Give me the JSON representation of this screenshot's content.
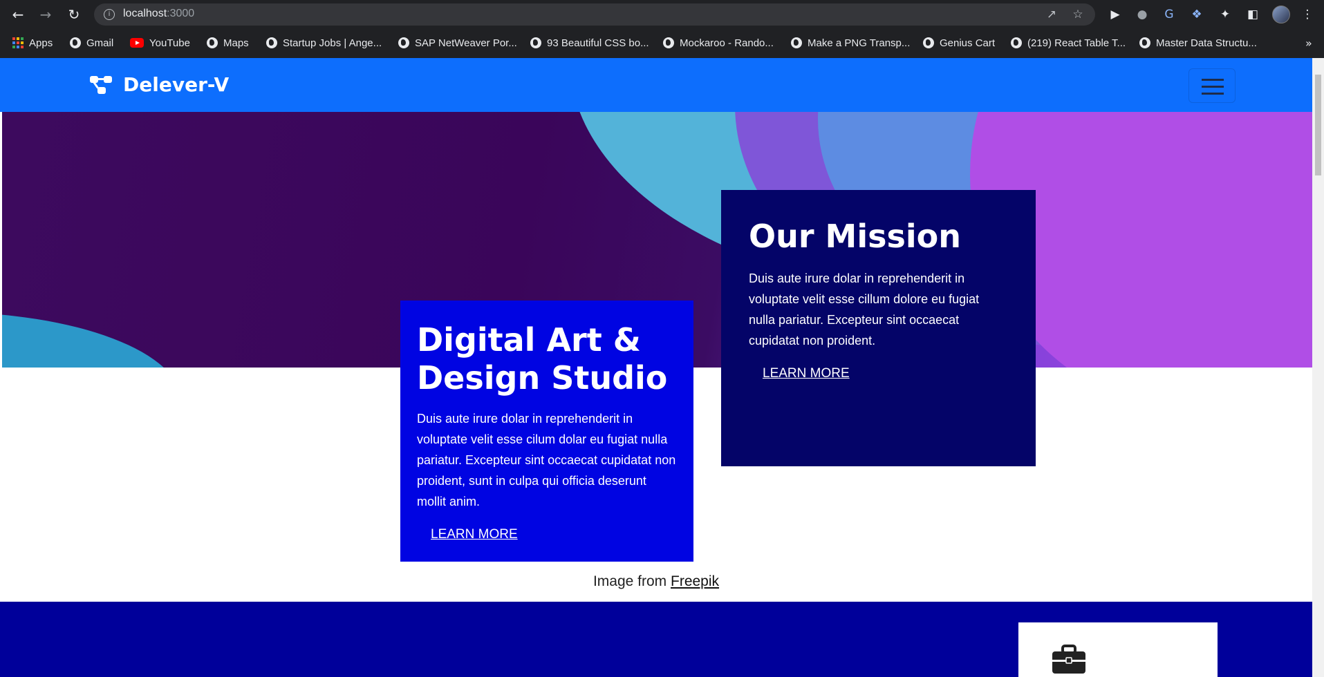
{
  "browser": {
    "url_host": "localhost",
    "url_port": ":3000",
    "bookmarks": [
      "Apps",
      "Gmail",
      "YouTube",
      "Maps",
      "Startup Jobs | Ange...",
      "SAP NetWeaver Por...",
      "93 Beautiful CSS bo...",
      "Mockaroo - Rando...",
      "Make a PNG Transp...",
      "Genius Cart",
      "(219) React Table T...",
      "Master Data Structu..."
    ],
    "more_bookmarks": "»"
  },
  "navbar": {
    "brand": "Delever-V",
    "color": "#0d6efd"
  },
  "cards": {
    "studio": {
      "title": "Digital Art & Design Studio",
      "body": "Duis aute irure dolar in reprehenderit in voluptate velit esse cilum dolar eu fugiat nulla pariatur. Excepteur sint occaecat cupidatat non proident, sunt in culpa qui officia deserunt mollit anim.",
      "link": "LEARN MORE",
      "color": "#0004e2"
    },
    "mission": {
      "title": "Our Mission",
      "body": "Duis aute irure dolar in reprehenderit in voluptate velit esse cillum dolore eu fugiat nulla pariatur. Excepteur sint occaecat cupidatat non proident.",
      "link": "LEARN MORE",
      "color": "#040468"
    }
  },
  "credit": {
    "prefix": "Image from",
    "link": "Freepik"
  },
  "footer": {
    "color": "#00009a"
  }
}
